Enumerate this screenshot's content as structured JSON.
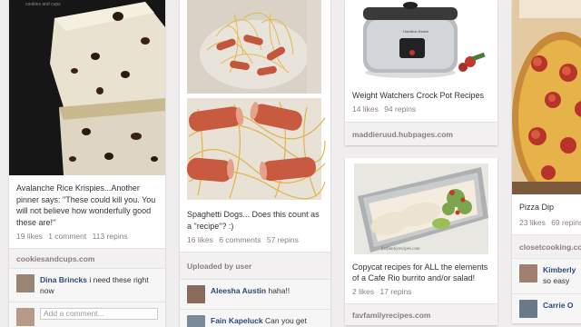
{
  "column1": {
    "pin_desc": "Avalanche Rice Krispies...Another pinner says: \"These could kill you. You will not believe how wonderfully good these are!\"",
    "stats": {
      "likes": "19 likes",
      "comments": "1 comment",
      "repins": "113 repins"
    },
    "source": "cookiesandcups.com",
    "image_watermark": "cookies and cups",
    "comment": {
      "user": "Dina Brincks",
      "text": "i need these right now"
    },
    "add_comment_placeholder": "Add a comment..."
  },
  "column2": {
    "pin_desc": "Spaghetti Dogs... Does this count as a \"recipe\"? :)",
    "stats": {
      "likes": "16 likes",
      "comments": "6 comments",
      "repins": "57 repins"
    },
    "source": "Uploaded by user",
    "comments": [
      {
        "user": "Aleesha Austin",
        "text": "haha!!"
      },
      {
        "user": "Fain Kapeluck",
        "text": "Can you get"
      }
    ]
  },
  "column3": {
    "pin1": {
      "desc": "Weight Watchers Crock Pot Recipes",
      "stats": {
        "likes": "14 likes",
        "repins": "94 repins"
      },
      "source": "maddieruud.hubpages.com",
      "crockpot_label": "Hamilton Beach"
    },
    "pin2": {
      "desc": "Copycat recipes for ALL the elements of a Cafe Rio burrito and/or salad!",
      "stats": {
        "likes": "2 likes",
        "repins": "17 repins"
      },
      "source": "favfamilyrecipes.com",
      "image_watermark": "favfamilyrecipes.com"
    }
  },
  "column4": {
    "pin_desc": "Pizza Dip",
    "stats": {
      "likes": "23 likes",
      "repins": "69 repins"
    },
    "source": "closetcooking.com",
    "comments": [
      {
        "user": "Kimberly",
        "text": "so easy"
      },
      {
        "user": "Carrie O",
        "text": ""
      }
    ]
  },
  "colors": {
    "background": "#efeded",
    "username": "#2a4a7a",
    "stats": "#8c7e7e"
  }
}
